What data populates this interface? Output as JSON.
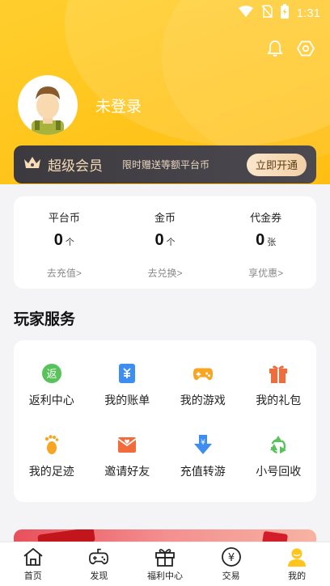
{
  "status": {
    "time": "1:31"
  },
  "user": {
    "name": "未登录"
  },
  "vip": {
    "title": "超级会员",
    "desc": "限时赠送等额平台币",
    "button": "立即开通"
  },
  "wallet": [
    {
      "label": "平台币",
      "value": "0",
      "unit": "个",
      "link": "去充值>"
    },
    {
      "label": "金币",
      "value": "0",
      "unit": "个",
      "link": "去兑换>"
    },
    {
      "label": "代金券",
      "value": "0",
      "unit": "张",
      "link": "享优惠>"
    }
  ],
  "services": {
    "title": "玩家服务",
    "items": [
      {
        "label": "返利中心",
        "icon": "rebate-icon"
      },
      {
        "label": "我的账单",
        "icon": "bill-icon"
      },
      {
        "label": "我的游戏",
        "icon": "gamepad-icon"
      },
      {
        "label": "我的礼包",
        "icon": "gift-icon"
      },
      {
        "label": "我的足迹",
        "icon": "footprint-icon"
      },
      {
        "label": "邀请好友",
        "icon": "invite-icon"
      },
      {
        "label": "充值转游",
        "icon": "transfer-icon"
      },
      {
        "label": "小号回收",
        "icon": "recycle-icon"
      }
    ]
  },
  "tabs": [
    {
      "label": "首页",
      "icon": "home-icon"
    },
    {
      "label": "发现",
      "icon": "controller-icon"
    },
    {
      "label": "福利中心",
      "icon": "gift-box-icon"
    },
    {
      "label": "交易",
      "icon": "yen-icon"
    },
    {
      "label": "我的",
      "icon": "user-icon"
    }
  ],
  "colors": {
    "accent": "#ffc51c",
    "vip_bg": "#3c3a3f",
    "vip_text": "#f6dcb7"
  }
}
